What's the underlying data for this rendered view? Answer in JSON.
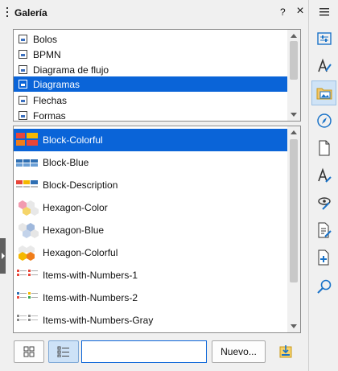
{
  "panel": {
    "title": "Galería",
    "help_label": "?",
    "close_label": "×"
  },
  "themes": {
    "items": [
      {
        "label": "Bolos",
        "selected": false
      },
      {
        "label": "BPMN",
        "selected": false
      },
      {
        "label": "Diagrama de flujo",
        "selected": false
      },
      {
        "label": "Diagramas",
        "selected": true
      },
      {
        "label": "Flechas",
        "selected": false
      },
      {
        "label": "Formas",
        "selected": false
      }
    ]
  },
  "gallery": {
    "items": [
      {
        "label": "Block-Colorful",
        "selected": true,
        "thumb": "block-colorful"
      },
      {
        "label": "Block-Blue",
        "selected": false,
        "thumb": "block-blue"
      },
      {
        "label": "Block-Description",
        "selected": false,
        "thumb": "block-description"
      },
      {
        "label": "Hexagon-Color",
        "selected": false,
        "thumb": "hexagon-color"
      },
      {
        "label": "Hexagon-Blue",
        "selected": false,
        "thumb": "hexagon-blue"
      },
      {
        "label": "Hexagon-Colorful",
        "selected": false,
        "thumb": "hexagon-colorful"
      },
      {
        "label": "Items-with-Numbers-1",
        "selected": false,
        "thumb": "items-numbers"
      },
      {
        "label": "Items-with-Numbers-2",
        "selected": false,
        "thumb": "items-numbers"
      },
      {
        "label": "Items-with-Numbers-Gray",
        "selected": false,
        "thumb": "items-numbers"
      }
    ]
  },
  "toolbar": {
    "icon_view": "icon-view-icon",
    "detail_view": "detail-view-icon",
    "search_value": "",
    "new_button_label": "Nuevo...",
    "insert_icon": "insert-into-document-icon"
  },
  "sidebar": {
    "menu_icon": "hamburger-menu-icon",
    "buttons": [
      "properties-icon",
      "styles-icon",
      "gallery-icon",
      "navigator-icon",
      "page-icon",
      "style-inspector-icon",
      "manage-changes-icon",
      "design-icon",
      "master-pages-icon",
      "find-icon"
    ]
  },
  "colors": {
    "selection": "#0a64d8",
    "accent_blue": "#1a73c8",
    "border": "#8c8c8c"
  }
}
